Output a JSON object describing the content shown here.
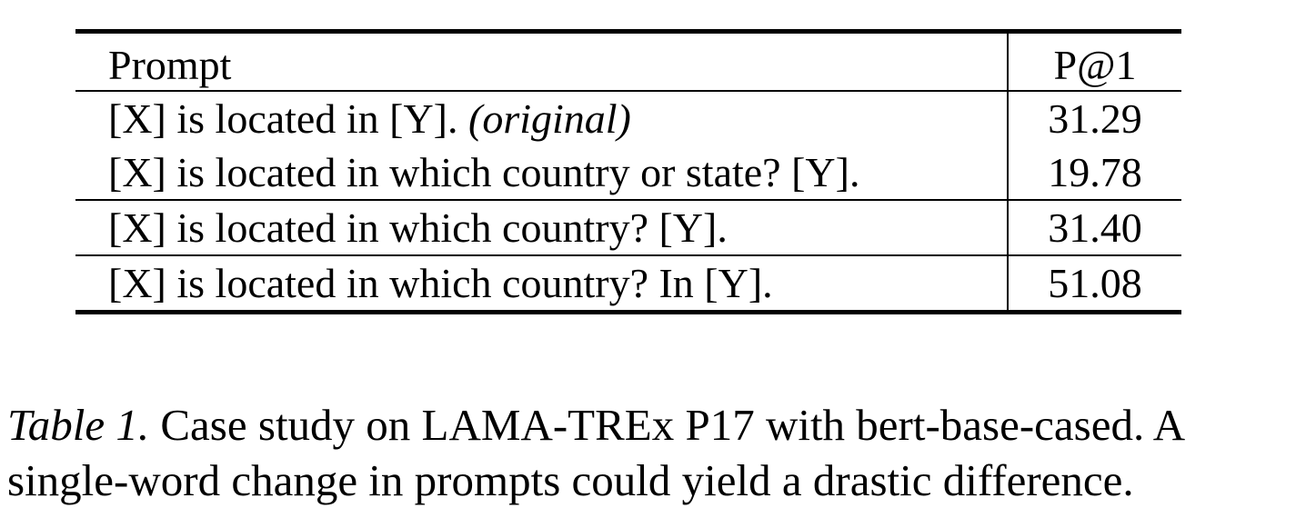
{
  "table": {
    "headers": {
      "prompt": "Prompt",
      "p1": "P@1"
    },
    "rows": [
      {
        "prompt": "[X] is located in [Y].",
        "note": "(original)",
        "p1": "31.29"
      },
      {
        "prompt": "[X] is located in which country or state? [Y].",
        "note": "",
        "p1": "19.78"
      },
      {
        "prompt": "[X] is located in which country? [Y].",
        "note": "",
        "p1": "31.40"
      },
      {
        "prompt": "[X] is located in which country? In [Y].",
        "note": "",
        "p1": "51.08"
      }
    ]
  },
  "caption": {
    "label": "Table 1.",
    "text": "Case study on LAMA-TREx P17 with bert-base-cased. A single-word change in prompts could yield a drastic difference."
  }
}
